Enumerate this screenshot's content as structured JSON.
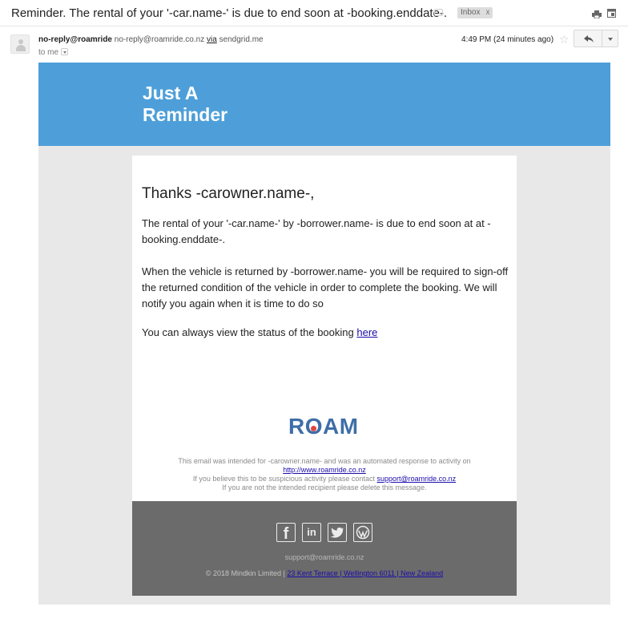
{
  "subject": {
    "text": "Reminder. The rental of your '-car.name-' is due to end soon at -booking.enddate-.",
    "label": "Inbox",
    "label_close": "x"
  },
  "sender": {
    "name": "no-reply@roamride",
    "email": "no-reply@roamride.co.nz",
    "via_word": "via",
    "via_domain": "sendgrid.me",
    "to": "to me",
    "timestamp": "4:49 PM (24 minutes ago)",
    "star_glyph": "☆"
  },
  "banner": {
    "title": "Just A Reminder",
    "color": "#4e9fd9"
  },
  "body": {
    "greeting": "Thanks -carowner.name-,",
    "paragraph_1": "The rental of your '-car.name-' by -borrower.name- is due to end soon at at -booking.enddate-.",
    "paragraph_2": "When the vehicle is returned by -borrower.name- you will be required to sign-off the returned condition of the vehicle in order to complete the booking. We will notify you again when it is time to do so",
    "paragraph_3_prefix": "You can always view the status of the booking",
    "paragraph_3_link": "here"
  },
  "logo": {
    "r": "R",
    "o": "O",
    "am": "AM",
    "color": "#3f6ea8",
    "dot_color": "#e0463c"
  },
  "footnote": {
    "line_1": "This email was intended for -carowner.name- and was an automated response to activity on",
    "line_2_link": "http://www.roamride.co.nz",
    "line_3_prefix": "If you believe this to be suspicious activity please contact",
    "line_3_link": "support@roamride.co.nz",
    "line_4": "If you are not the intended recipient please delete this message."
  },
  "footer": {
    "facebook_glyph": "f",
    "linkedin_glyph": "in",
    "email": "support@roamride.co.nz",
    "copyright_prefix": "© 2018 Mindkin Limited |",
    "address_link": "23 Kent Terrace | Wellington 6011 | New Zealand",
    "band_color": "#6b6b6b"
  }
}
